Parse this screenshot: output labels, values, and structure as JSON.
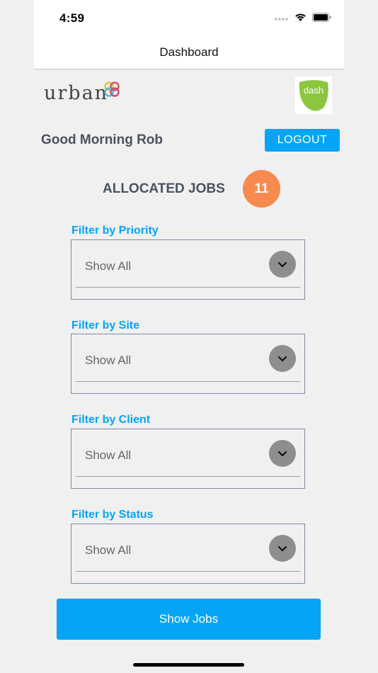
{
  "status_bar": {
    "time": "4:59"
  },
  "nav": {
    "title": "Dashboard"
  },
  "logos": {
    "urban": "urban",
    "dash": "dash"
  },
  "header": {
    "greeting": "Good Morning Rob",
    "logout_label": "LOGOUT"
  },
  "allocated": {
    "title": "ALLOCATED JOBS",
    "count": "11"
  },
  "filters": [
    {
      "label": "Filter by Priority",
      "value": "Show All"
    },
    {
      "label": "Filter by Site",
      "value": "Show All"
    },
    {
      "label": "Filter by Client",
      "value": "Show All"
    },
    {
      "label": "Filter by Status",
      "value": "Show All"
    }
  ],
  "actions": {
    "show_jobs_label": "Show Jobs"
  },
  "colors": {
    "accent": "#06a4f4",
    "badge": "#f78a4e",
    "heading": "#4a5260",
    "background": "#f0f0f0"
  }
}
